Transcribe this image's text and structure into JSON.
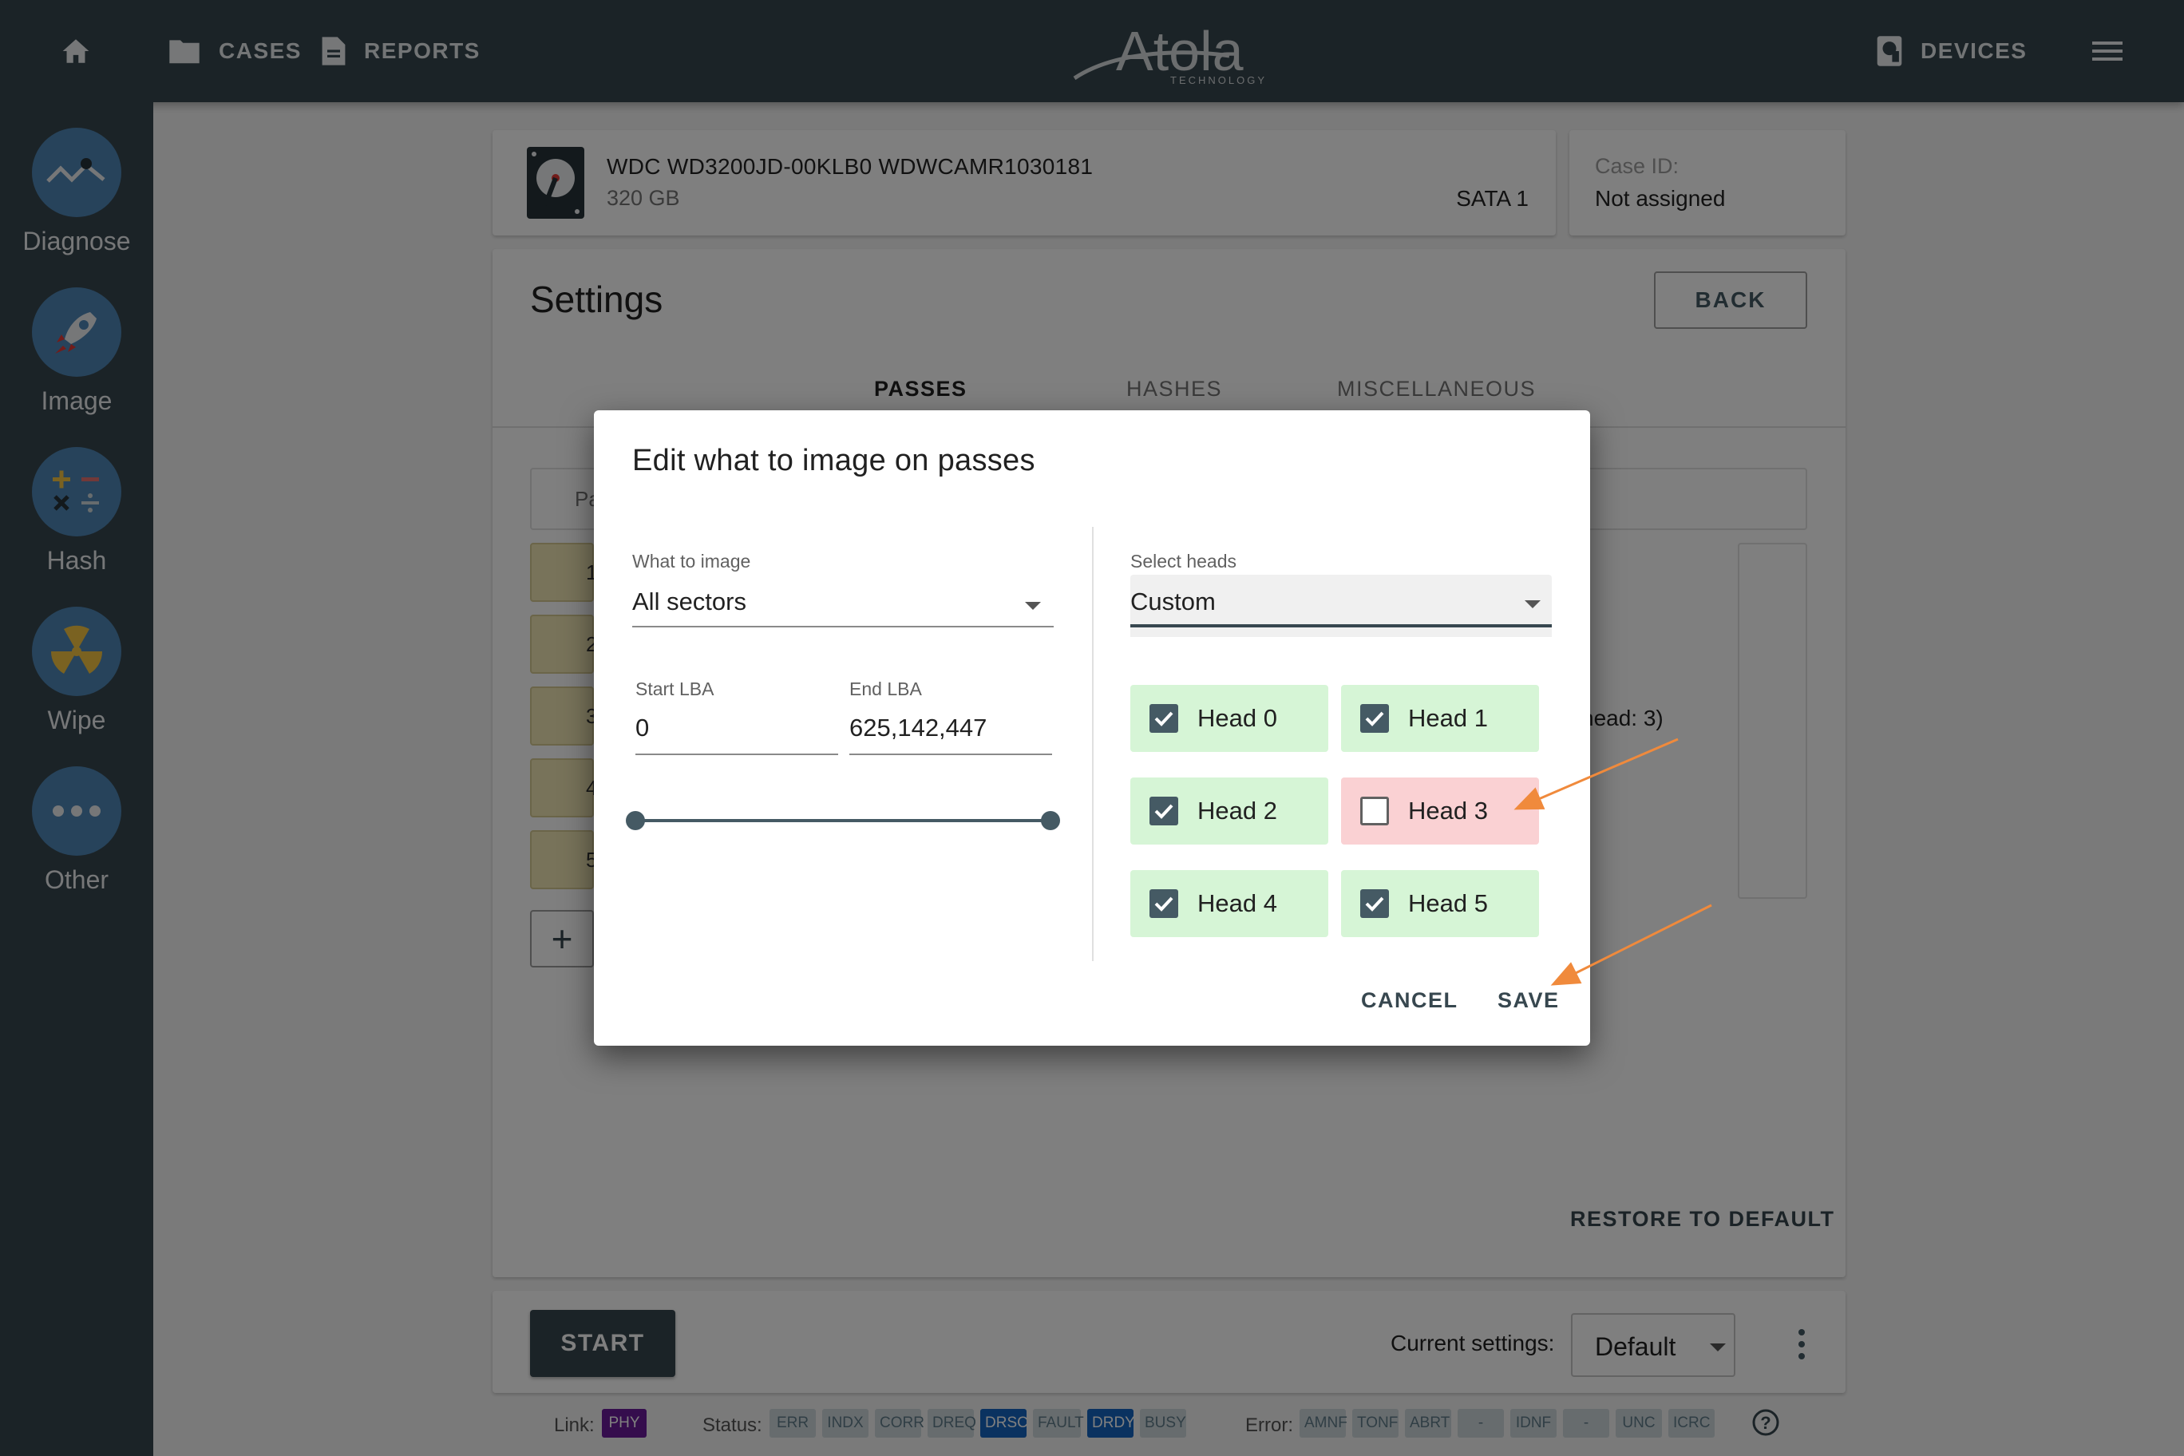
{
  "nav": {
    "cases": "CASES",
    "reports": "REPORTS",
    "logo_text": "Atola",
    "logo_sub": "TECHNOLOGY",
    "devices": "DEVICES"
  },
  "sidebar": {
    "items": [
      {
        "label": "Diagnose",
        "icon": "diagnose-icon"
      },
      {
        "label": "Image",
        "icon": "rocket-icon"
      },
      {
        "label": "Hash",
        "icon": "calculator-icon"
      },
      {
        "label": "Wipe",
        "icon": "radiation-icon"
      },
      {
        "label": "Other",
        "icon": "more-icon"
      }
    ]
  },
  "device": {
    "model": "WDC WD3200JD-00KLB0 WDWCAMR1030181",
    "size": "320 GB",
    "interface": "SATA 1"
  },
  "case": {
    "label": "Case ID:",
    "value": "Not assigned"
  },
  "settings": {
    "title": "Settings",
    "back": "BACK",
    "tabs": [
      "PASSES",
      "HASHES",
      "MISCELLANEOUS"
    ],
    "passes_header_fragment": "Pa",
    "row_numbers": [
      "1",
      "2",
      "3",
      "4",
      "5"
    ],
    "info_fragment": "head: 3)",
    "add": "+",
    "restore": "RESTORE TO DEFAULT"
  },
  "bottom": {
    "start": "START",
    "current_label": "Current settings:",
    "current_value": "Default"
  },
  "status_bar": {
    "link_label": "Link:",
    "link_chips": [
      "PHY"
    ],
    "status_label": "Status:",
    "status_chips": [
      "ERR",
      "INDX",
      "CORR",
      "DREQ",
      "DRSC",
      "FAULT",
      "DRDY",
      "BUSY"
    ],
    "error_label": "Error:",
    "error_chips": [
      "AMNF",
      "TONF",
      "ABRT",
      "-",
      "IDNF",
      "-",
      "UNC",
      "ICRC"
    ],
    "colors": {
      "purple": "#6a1b9a",
      "blue": "#1565c0",
      "inactive": "#cfd8dc"
    }
  },
  "dialog": {
    "title": "Edit what to image on passes",
    "what_label": "What to image",
    "what_value": "All sectors",
    "start_label": "Start LBA",
    "start_value": "0",
    "end_label": "End LBA",
    "end_value": "625,142,447",
    "heads_label": "Select heads",
    "heads_value": "Custom",
    "heads": [
      {
        "label": "Head 0",
        "checked": true
      },
      {
        "label": "Head 1",
        "checked": true
      },
      {
        "label": "Head 2",
        "checked": true
      },
      {
        "label": "Head 3",
        "checked": false
      },
      {
        "label": "Head 4",
        "checked": true
      },
      {
        "label": "Head 5",
        "checked": true
      }
    ],
    "cancel": "CANCEL",
    "save": "SAVE",
    "annotation_color": "#f08a3c"
  }
}
